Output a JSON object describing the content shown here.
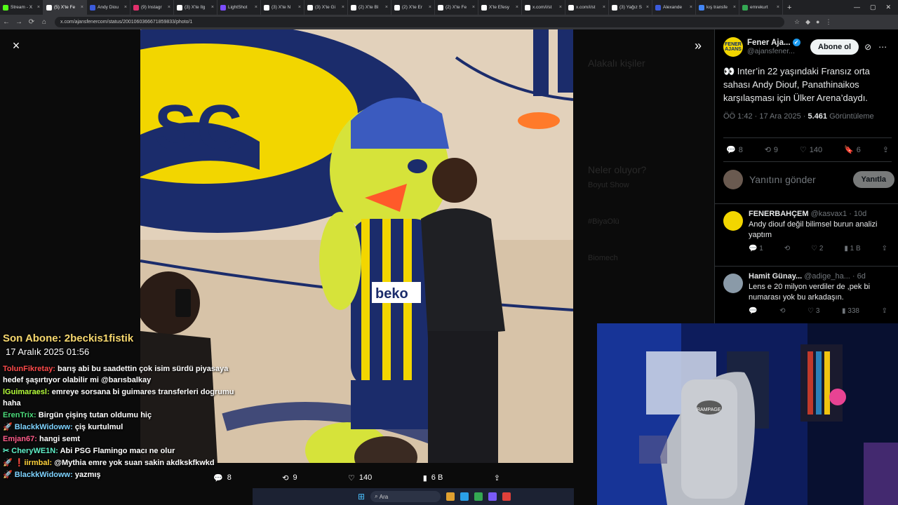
{
  "browser": {
    "tabs": [
      {
        "title": "Stream - X",
        "color": "#53fc18",
        "active": false
      },
      {
        "title": "(5) X'te Fe",
        "color": "#ffffff",
        "active": true
      },
      {
        "title": "Andy Diou",
        "color": "#3b5bdb",
        "active": false
      },
      {
        "title": "(9) Instagr",
        "color": "#e1306c",
        "active": false
      },
      {
        "title": "(3) X'te İlg",
        "color": "#ffffff",
        "active": false
      },
      {
        "title": "LightShot",
        "color": "#7c4dff",
        "active": false
      },
      {
        "title": "(3) X'te N",
        "color": "#ffffff",
        "active": false
      },
      {
        "title": "(3) X'te Gi",
        "color": "#ffffff",
        "active": false
      },
      {
        "title": "(2) X'te Bl",
        "color": "#ffffff",
        "active": false
      },
      {
        "title": "(2) X'te Er",
        "color": "#ffffff",
        "active": false
      },
      {
        "title": "(2) X'te Fe",
        "color": "#ffffff",
        "active": false
      },
      {
        "title": "X'te Efesy",
        "color": "#ffffff",
        "active": false
      },
      {
        "title": "x.com/i/st",
        "color": "#ffffff",
        "active": false
      },
      {
        "title": "x.com/i/st",
        "color": "#ffffff",
        "active": false
      },
      {
        "title": "(3) Yağız S",
        "color": "#ffffff",
        "active": false
      },
      {
        "title": "Alexande",
        "color": "#3b5bdb",
        "active": false
      },
      {
        "title": "kış transfe",
        "color": "#4285f4",
        "active": false
      },
      {
        "title": "emrekurt",
        "color": "#34a853",
        "active": false
      }
    ],
    "url": "x.com/ajansfenercom/status/2001060366671859833/photo/1"
  },
  "viewer": {
    "close_icon": "×",
    "expand_icon": "»",
    "actions": {
      "replies": "8",
      "reposts": "9",
      "likes": "140",
      "views": "6 B"
    }
  },
  "background_ghost": {
    "related": "Alakalı kişiler",
    "trending": "Neler oluyor?",
    "trend1": "Boyut Show",
    "trend2": "#BiyaOlü",
    "trend3": "Biomech"
  },
  "panel": {
    "avatar_text": "FENER AJANS",
    "name": "Fener Aja...",
    "handle": "@ajansfener...",
    "follow_label": "Abone ol",
    "tweet_text": "👀 Inter’in 22 yaşındaki Fransız orta sahası Andy Diouf, Panathinaikos karşılaşması için Ülker Arena’daydı.",
    "tweet_time": "ÖÖ 1:42 · 17 Ara 2025 · ",
    "tweet_views": "5.461",
    "tweet_views_label": "Görüntüleme",
    "stats": {
      "replies": "8",
      "reposts": "9",
      "likes": "140",
      "bookmarks": "6"
    },
    "reply_placeholder": "Yanıtını gönder",
    "reply_button": "Yanıtla",
    "replies": [
      {
        "name": "FENERBAHÇEM",
        "handle": "@kasvax1 · 10d",
        "text": "Andy diouf değil bilimsel burun analizi yaptım",
        "replies": "1",
        "likes": "2",
        "views": "1 B",
        "avatar_color": "#f2d600"
      },
      {
        "name": "Hamit Günay...",
        "handle": "@adige_ha... · 6d",
        "text": "Lens e 20 milyon verdiler de ,pek bi numarası yok bu arkadaşın.",
        "replies": "",
        "likes": "3",
        "views": "338",
        "avatar_color": "#8a9aa8"
      }
    ]
  },
  "stream_overlay": {
    "last_sub_label": "Son Abone: 2beckis1fistik",
    "date": "17 Aralık 2025  01:56",
    "chat": [
      {
        "user": "TolunFikretay:",
        "color": "#ff4b4b",
        "msg": "barış abi bu saadettin çok isim sürdü piyasaya hedef şaşırtıyor olabilir mi @barısbalkay"
      },
      {
        "user": "lGuimaraesl:",
        "color": "#b6ff3b",
        "msg": "emreye sorsana bi guimares transferleri dogrumu haha"
      },
      {
        "user": "ErenTrix:",
        "color": "#4bdb7a",
        "msg": "Birgün çişinş tutan oldumu hiç"
      },
      {
        "user": "🚀 BlackkWidoww:",
        "color": "#7ed3ff",
        "msg": "çiş kurtulmul"
      },
      {
        "user": "Emjan67:",
        "color": "#ff5c8a",
        "msg": "hangi semt"
      },
      {
        "user": "✂ CheryWE1N:",
        "color": "#5ff0c8",
        "msg": "Abi PSG Flamingo macı ne olur"
      },
      {
        "user": "🚀 ❗iirmbal:",
        "color": "#ffd23b",
        "msg": "@Mythia emre yok suan sakin akdkskfkwkd"
      },
      {
        "user": "🚀 BlackkWidoww:",
        "color": "#7ed3ff",
        "msg": "yazmış"
      }
    ]
  },
  "taskbar": {
    "search_label": "Ara"
  },
  "colors": {
    "accent": "#1d9bf0",
    "fener_yellow": "#f2d600",
    "fener_navy": "#1b2c6b"
  }
}
